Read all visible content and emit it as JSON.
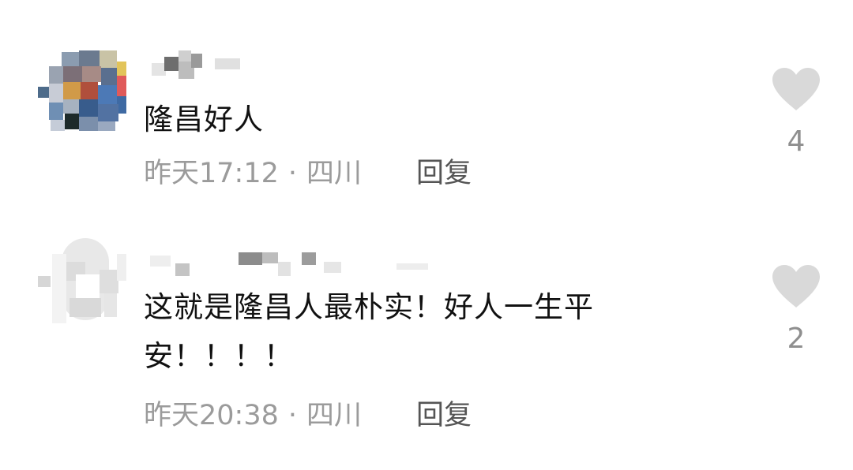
{
  "comments": [
    {
      "content": "隆昌好人",
      "time": "昨天17:12",
      "separator": "·",
      "location": "四川",
      "reply_label": "回复",
      "likes": "4"
    },
    {
      "content": "这就是隆昌人最朴实！好人一生平安！！！！",
      "time": "昨天20:38",
      "separator": "·",
      "location": "四川",
      "reply_label": "回复",
      "likes": "2"
    }
  ],
  "colors": {
    "text": "#111111",
    "meta": "#9b9b9b",
    "reply": "#555555",
    "heart": "#d9d9d9"
  },
  "icons": {
    "like": "heart-icon"
  }
}
